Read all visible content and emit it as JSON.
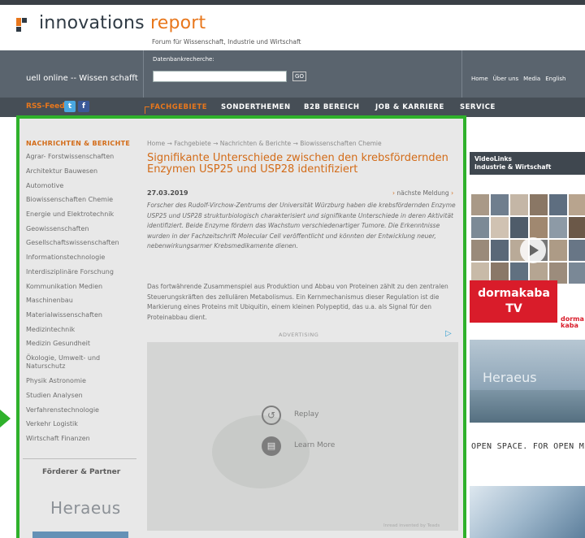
{
  "header": {
    "logo_part1": "innovations",
    "logo_part2": "report",
    "tagline": "Forum für Wissenschaft, Industrie und Wirtschaft"
  },
  "searchbar": {
    "slogan": "uell online -- Wissen schafft",
    "db_label": "Datenbankrecherche:",
    "input_value": "",
    "go_label": "GO",
    "links": [
      "Home",
      "Über uns",
      "Media",
      "English"
    ]
  },
  "nav": {
    "rss_label": "RSS-Feed",
    "twitter_glyph": "t",
    "facebook_glyph": "f",
    "items": [
      "FACHGEBIETE",
      "SONDERTHEMEN",
      "B2B BEREICH",
      "JOB & KARRIERE",
      "SERVICE"
    ],
    "active_index": 0
  },
  "sidebar": {
    "heading": "NACHRICHTEN & BERICHTE",
    "categories": [
      "Agrar- Forstwissenschaften",
      "Architektur Bauwesen",
      "Automotive",
      "Biowissenschaften Chemie",
      "Energie und Elektrotechnik",
      "Geowissenschaften",
      "Gesellschaftswissenschaften",
      "Informationstechnologie",
      "Interdisziplinäre Forschung",
      "Kommunikation Medien",
      "Maschinenbau",
      "Materialwissenschaften",
      "Medizintechnik",
      "Medizin Gesundheit",
      "Ökologie, Umwelt- und Naturschutz",
      "Physik Astronomie",
      "Studien Analysen",
      "Verfahrenstechnologie",
      "Verkehr Logistik",
      "Wirtschaft Finanzen"
    ],
    "partners_heading": "Förderer & Partner",
    "partner_logo": "Heraeus"
  },
  "article": {
    "breadcrumb": "Home → Fachgebiete → Nachrichten & Berichte → Biowissenschaften Chemie",
    "title": "Signifikante Unterschiede zwischen den krebsfördernden Enzymen USP25 und USP28 identifiziert",
    "date": "27.03.2019",
    "next_label": "nächste Meldung",
    "lead": "Forscher des Rudolf-Virchow-Zentrums der Universität Würzburg haben die krebsfördernden Enzyme USP25 und USP28 strukturbiologisch charakterisiert und signifikante Unterschiede in deren Aktivität identifiziert. Beide Enzyme fördern das Wachstum verschiedenartiger Tumore. Die Erkenntnisse wurden in der Fachzeitschrift Molecular Cell veröffentlicht und könnten der Entwicklung neuer, nebenwirkungsarmer Krebsmedikamente dienen.",
    "body": "Das fortwährende Zusammenspiel aus Produktion und Abbau von Proteinen zählt zu den zentralen Steuerungskräften des zellulären Metabolismus. Ein Kernmechanismus dieser Regulation ist die Markierung eines Proteins mit Ubiquitin, einem kleinen Polypeptid, das u.a. als Signal für den Proteinabbau dient."
  },
  "ad": {
    "label": "ADVERTISING",
    "replay": "Replay",
    "learn_more": "Learn More",
    "powered_by": "Inread invented by Teads"
  },
  "right": {
    "videolinks_line1": "VideoLinks",
    "videolinks_line2": "Industrie & Wirtschaft",
    "dormakaba_line1": "dormakaba",
    "dormakaba_line2": "TV",
    "dormakaba_side1": "dorma",
    "dormakaba_side2": "kaba",
    "heraeus_ad_logo": "Heraeus",
    "heraeus_ad_slogan": "OPEN SPACE. FOR OPEN MIND"
  },
  "colors": {
    "brand_orange": "#e8771c",
    "highlight_green": "#2fb12b",
    "dormakaba_red": "#d91c2a"
  }
}
